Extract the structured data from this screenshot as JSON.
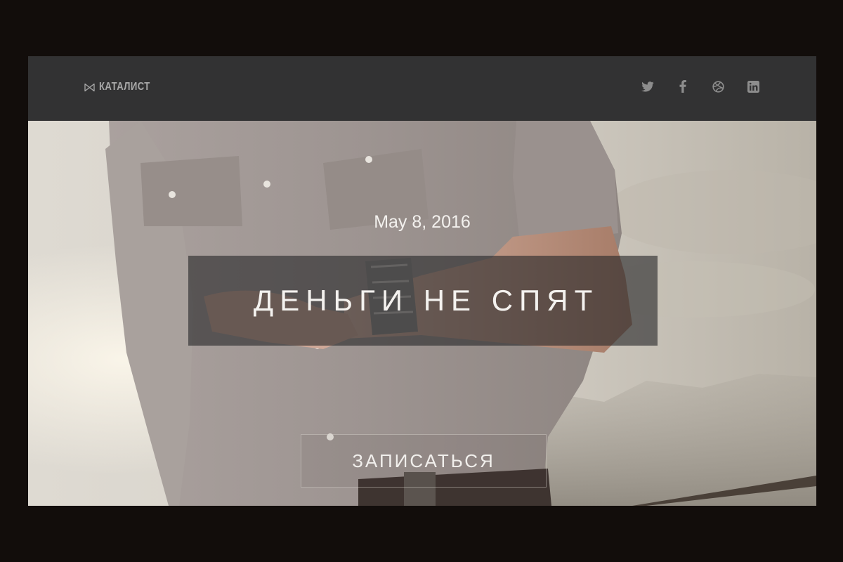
{
  "header": {
    "brand_name": "КАТАЛИСТ",
    "brand_icon": "bowtie-icon",
    "social": [
      {
        "name": "twitter",
        "icon": "twitter-icon"
      },
      {
        "name": "facebook",
        "icon": "facebook-icon"
      },
      {
        "name": "dribbble",
        "icon": "dribbble-icon"
      },
      {
        "name": "linkedin",
        "icon": "linkedin-icon"
      }
    ]
  },
  "hero": {
    "date": "May 8, 2016",
    "title": "ДЕНЬГИ НЕ СПЯТ",
    "cta_label": "ЗАПИСАТЬСЯ"
  },
  "colors": {
    "page_background": "#120d0b",
    "header_background": "#323233",
    "header_text": "#a9a9a9",
    "banner_background": "#28282a",
    "hero_text": "#f4f2ef"
  }
}
